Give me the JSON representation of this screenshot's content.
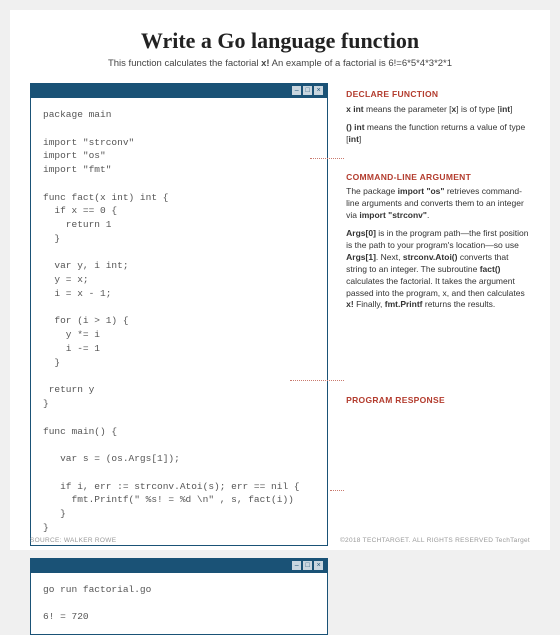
{
  "title": "Write a Go language function",
  "subtitle_prefix": "This function calculates the factorial ",
  "subtitle_bold": "x!",
  "subtitle_suffix": " An example of a factorial is 6!=6*5*4*3*2*1",
  "code_main": "package main\n\nimport \"strconv\"\nimport \"os\"\nimport \"fmt\"\n\nfunc fact(x int) int {\n  if x == 0 {\n    return 1\n  }\n\n  var y, i int;\n  y = x;\n  i = x - 1;\n\n  for (i > 1) {\n    y *= i\n    i -= 1\n  }\n\n return y\n}\n\nfunc main() {\n\n   var s = (os.Args[1]);\n\n   if i, err := strconv.Atoi(s); err == nil {\n     fmt.Printf(\" %s! = %d \\n\" , s, fact(i))\n   }\n}",
  "code_output": "go run factorial.go\n\n6! = 720",
  "window_buttons": {
    "min": "–",
    "max": "□",
    "close": "×"
  },
  "annotations": {
    "declare": {
      "heading": "DECLARE FUNCTION",
      "line1_a": "x int",
      "line1_b": " means the parameter [",
      "line1_c": "x",
      "line1_d": "] is of type [",
      "line1_e": "int",
      "line1_f": "]",
      "line2_a": "() int",
      "line2_b": "  means the function returns a value of type [",
      "line2_c": "int",
      "line2_d": "]"
    },
    "cli": {
      "heading": "COMMAND-LINE ARGUMENT",
      "p1_a": "The package ",
      "p1_b": "import \"os\"",
      "p1_c": " retrieves command-line arguments and converts them to an integer via ",
      "p1_d": "import \"strconv\"",
      "p1_e": ".",
      "p2_a": "Args[0]",
      "p2_b": " is in the program path—the first position is the path to your program's location—so use ",
      "p2_c": "Args[1]",
      "p2_d": ". Next, ",
      "p2_e": "strconv.Atoi()",
      "p2_f": " converts that string to an integer. The subroutine ",
      "p2_g": "fact()",
      "p2_h": " calculates the factorial.  It takes the argument passed into the program, x, and then calculates ",
      "p2_i": "x!",
      "p2_j": " Finally, ",
      "p2_k": "fmt.Printf",
      "p2_l": " returns the results."
    },
    "response": {
      "heading": "PROGRAM RESPONSE"
    }
  },
  "footer": {
    "left": "SOURCE: WALKER ROWE",
    "right": "©2018 TECHTARGET. ALL RIGHTS RESERVED    TechTarget"
  }
}
